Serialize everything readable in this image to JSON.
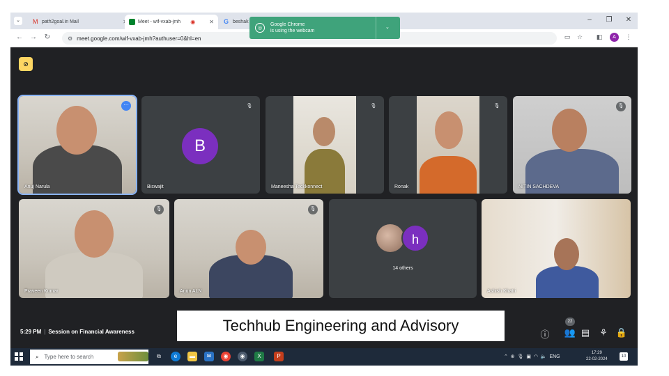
{
  "browser": {
    "tabs": [
      {
        "label": "path2goal.in Mail",
        "icon": "gmail-icon"
      },
      {
        "label": "Meet - wif-vxab-jmh",
        "icon": "meet-icon",
        "active": true,
        "recording": true
      },
      {
        "label": "beshak",
        "icon": "google-icon"
      }
    ],
    "url": "meet.google.com/wif-vxab-jmh?authuser=0&hl=en",
    "profile_letter": "A"
  },
  "notification": {
    "title": "Google Chrome",
    "message": "is using the webcam"
  },
  "participants": [
    {
      "name": "Anuj Narula",
      "selected": true
    },
    {
      "name": "Biswajit",
      "avatar_letter": "B"
    },
    {
      "name": "Maneesha Teckkonnect"
    },
    {
      "name": "Ronak"
    },
    {
      "name": "NITIN SACHDEVA"
    },
    {
      "name": "Praveen Kumar"
    },
    {
      "name": "Arjun ALN"
    },
    {
      "name": "Ashish Khatri"
    }
  ],
  "others": {
    "avatar_letter": "h",
    "label": "14 others"
  },
  "bottom_bar": {
    "time": "5:29 PM",
    "meeting_title": "Session on Financial Awareness",
    "people_count": "22"
  },
  "banner": {
    "text": "Techhub Engineering and Advisory"
  },
  "taskbar": {
    "search_placeholder": "Type here to search",
    "language": "ENG",
    "time": "17:29",
    "date": "22-02-2024",
    "notification_count": "10"
  },
  "colors": {
    "meet_background": "#202124",
    "tile_background": "#3c4043",
    "avatar_purple": "#7b2fbf",
    "notification_green": "#3fa37b",
    "selected_outline": "#8ab4f8"
  }
}
